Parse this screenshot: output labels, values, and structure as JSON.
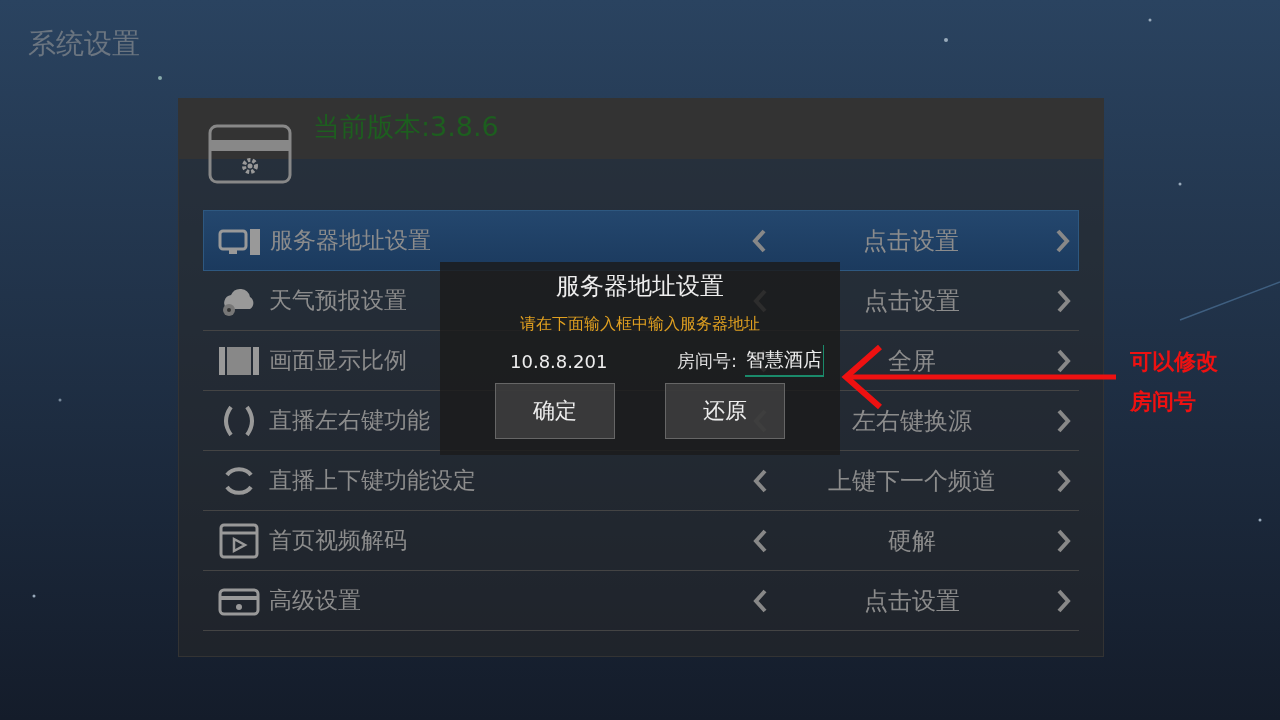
{
  "page_title": "系统设置",
  "header": {
    "version": "当前版本:3.8.6"
  },
  "rows": [
    {
      "label": "服务器地址设置",
      "value": "点击设置",
      "selected": true
    },
    {
      "label": "天气预报设置",
      "value": "点击设置",
      "selected": false
    },
    {
      "label": "画面显示比例",
      "value": "全屏",
      "selected": false
    },
    {
      "label": "直播左右键功能",
      "value": "左右键换源",
      "selected": false
    },
    {
      "label": "直播上下键功能设定",
      "value": "上键下一个频道",
      "selected": false
    },
    {
      "label": "首页视频解码",
      "value": "硬解",
      "selected": false
    },
    {
      "label": "高级设置",
      "value": "点击设置",
      "selected": false
    }
  ],
  "dialog": {
    "title": "服务器地址设置",
    "hint": "请在下面输入框中输入服务器地址",
    "server_address": "10.8.8.201",
    "room_label": "房间号:",
    "room_value": "智慧酒店",
    "buttons": [
      "确定",
      "还原"
    ]
  },
  "annotation": {
    "lines": [
      "可以修改",
      "房间号"
    ]
  }
}
